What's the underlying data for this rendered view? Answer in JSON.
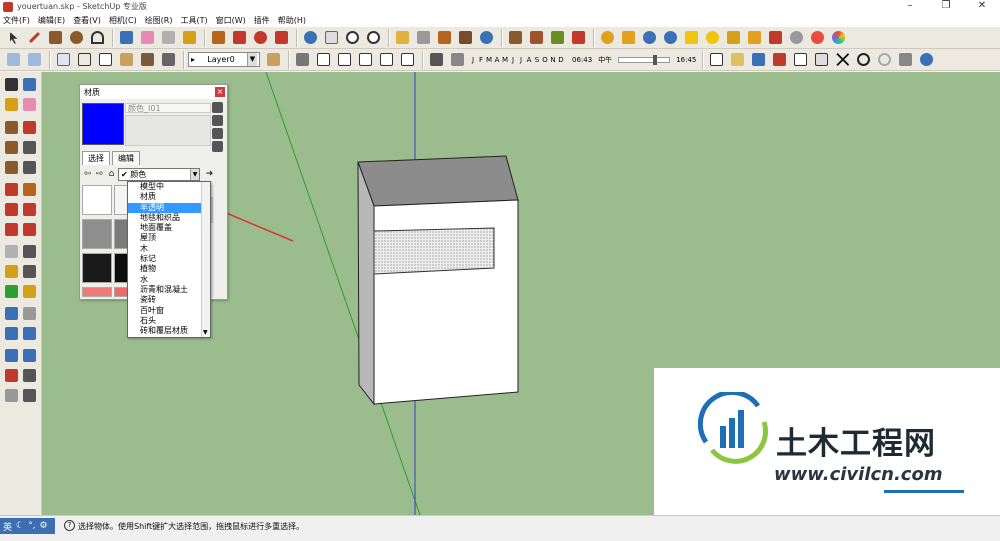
{
  "window": {
    "title": "youertuan.skp - SketchUp 专业版",
    "controls": [
      "–",
      "❐",
      "✕"
    ]
  },
  "menu": [
    "文件(F)",
    "编辑(E)",
    "查看(V)",
    "相机(C)",
    "绘图(R)",
    "工具(T)",
    "窗口(W)",
    "插件",
    "帮助(H)"
  ],
  "toolbar": {
    "layer": "Layer0",
    "months": [
      "J",
      "F",
      "M",
      "A",
      "M",
      "J",
      "J",
      "A",
      "S",
      "O",
      "N",
      "D"
    ],
    "time_start": "06:43",
    "time_mid": "中午",
    "time_end": "16:45"
  },
  "materials_panel": {
    "title": "材质",
    "material_name": "颜色_I01",
    "tabs": [
      "选择",
      "编辑"
    ],
    "collection": "颜色",
    "swatch_color": "#0000ff"
  },
  "dropdown": {
    "items": [
      "模型中",
      "材质",
      "半透明",
      "地毯和织品",
      "地面覆盖",
      "屋顶",
      "木",
      "标记",
      "植物",
      "水",
      "沥青和混凝土",
      "瓷砖",
      "百叶窗",
      "石头",
      "砖和覆层材质"
    ],
    "selected": "半透明"
  },
  "status": {
    "ime": [
      "英",
      "☾",
      "°,",
      "⚙"
    ],
    "help": "?",
    "text": "选择物体。使用Shift键扩大选择范围，拖拽鼠标进行多重选择。"
  },
  "watermark": {
    "brand": "土木工程网",
    "url": "www.civilcn.com"
  },
  "colors": {
    "viewport": "#9bbd8d",
    "selected": "#3399ff"
  }
}
